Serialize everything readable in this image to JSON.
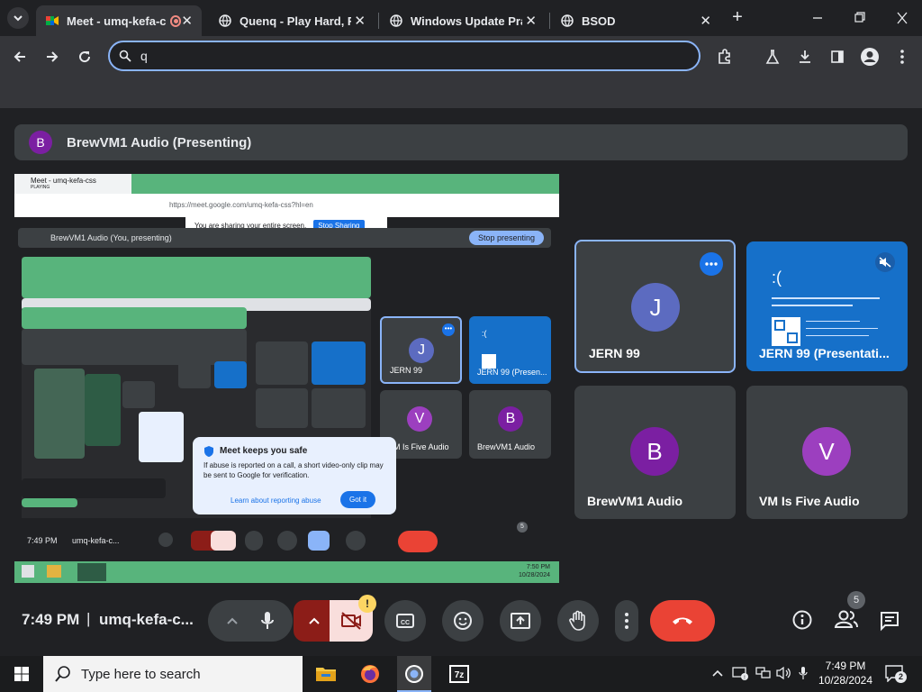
{
  "browser": {
    "tabs": [
      {
        "title": "Meet - umq-kefa-c",
        "active": true
      },
      {
        "title": "Quenq - Play Hard, Fa",
        "active": false
      },
      {
        "title": "Windows Update Pran",
        "active": false
      },
      {
        "title": "BSOD",
        "active": false
      }
    ],
    "new_tab_symbol": "+",
    "omnibox_value": "q"
  },
  "meet": {
    "presenting_banner": {
      "avatar_letter": "B",
      "text": "BrewVM1 Audio (Presenting)"
    },
    "shared_screen": {
      "mini_tab_title": "Meet - umq-kefa-css",
      "mini_tab_sub": "PLAYING",
      "mini_url": "https://meet.google.com/umq-kefa-css?hl=en",
      "sharing_notice": "You are sharing your entire screen.",
      "stop_sharing": "Stop Sharing",
      "inner_banner": "BrewVM1 Audio (You, presenting)",
      "stop_presenting": "Stop presenting",
      "tiles": [
        {
          "letter": "J",
          "name": "JERN 99"
        },
        {
          "letter": "",
          "name": "JERN 99 (Presen..."
        },
        {
          "letter": "V",
          "name": "VM Is Five Audio"
        },
        {
          "letter": "B",
          "name": "BrewVM1 Audio"
        }
      ],
      "safe_card": {
        "heading": "Meet keeps you safe",
        "body": "If abuse is reported on a call, a short video-only clip may be sent to Google for verification.",
        "link": "Learn about reporting abuse",
        "button": "Got it"
      },
      "mini_time": "7:49 PM",
      "mini_code": "umq-kefa-c...",
      "mini_participants": "5",
      "mini_clock_time": "7:50 PM",
      "mini_clock_date": "10/28/2024"
    },
    "participants": [
      {
        "letter": "J",
        "name": "JERN 99",
        "color": "#5c6bc0"
      },
      {
        "letter": "",
        "name": "JERN 99 (Presentati...",
        "color": "#1670c9"
      },
      {
        "letter": "B",
        "name": "BrewVM1 Audio",
        "color": "#7b1fa2"
      },
      {
        "letter": "V",
        "name": "VM Is Five Audio",
        "color": "#9c3fbf"
      }
    ],
    "bsod_face": ":(",
    "controls": {
      "time": "7:49 PM",
      "separator": "|",
      "meeting_code": "umq-kefa-c...",
      "warning_badge": "!",
      "participant_count": "5"
    }
  },
  "taskbar": {
    "search_placeholder": "Type here to search",
    "clock_time": "7:49 PM",
    "clock_date": "10/28/2024",
    "notification_count": "2"
  }
}
